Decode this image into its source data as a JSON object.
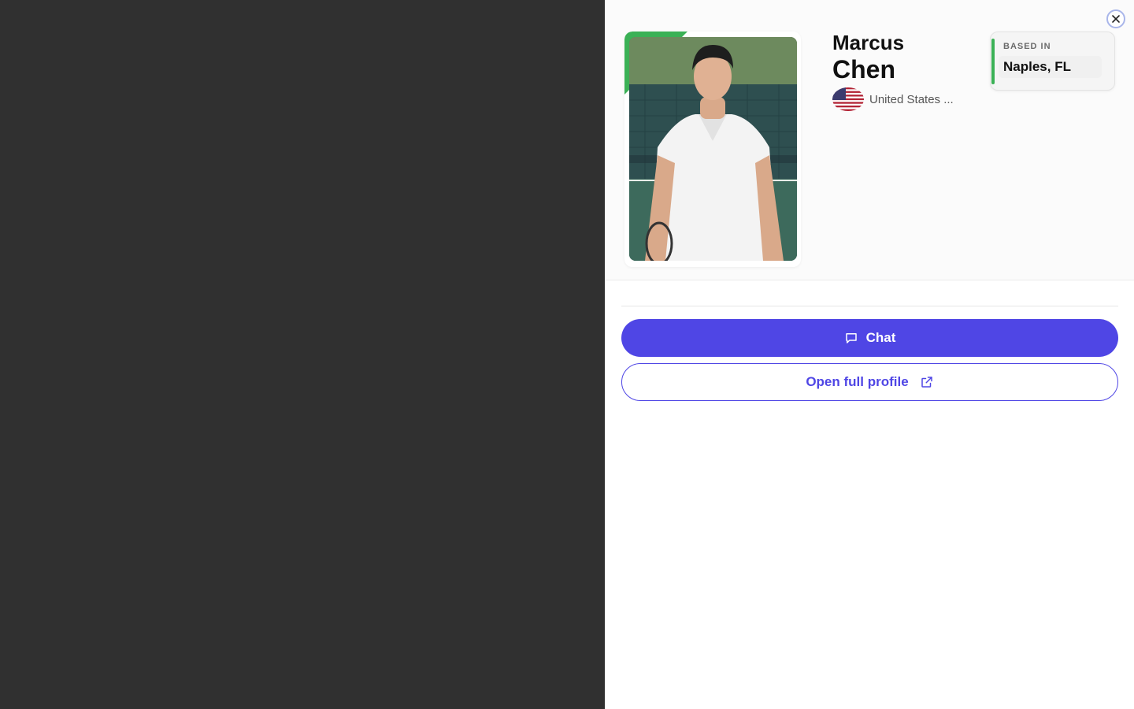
{
  "profile": {
    "first_name": "Marcus",
    "last_name": "Chen",
    "country": "United States ...",
    "based_in_label": "BASED IN",
    "based_in_value": "Naples, FL",
    "photo_icon": "profile-photo"
  },
  "actions": {
    "chat_label": "Chat",
    "open_profile_label": "Open full profile"
  },
  "icons": {
    "close": "close-icon",
    "chat": "chat-bubble-icon",
    "external": "external-link-icon",
    "flag": "us-flag-icon"
  },
  "colors": {
    "accent": "#4f46e5",
    "green": "#3bb156",
    "backdrop": "#303030"
  }
}
